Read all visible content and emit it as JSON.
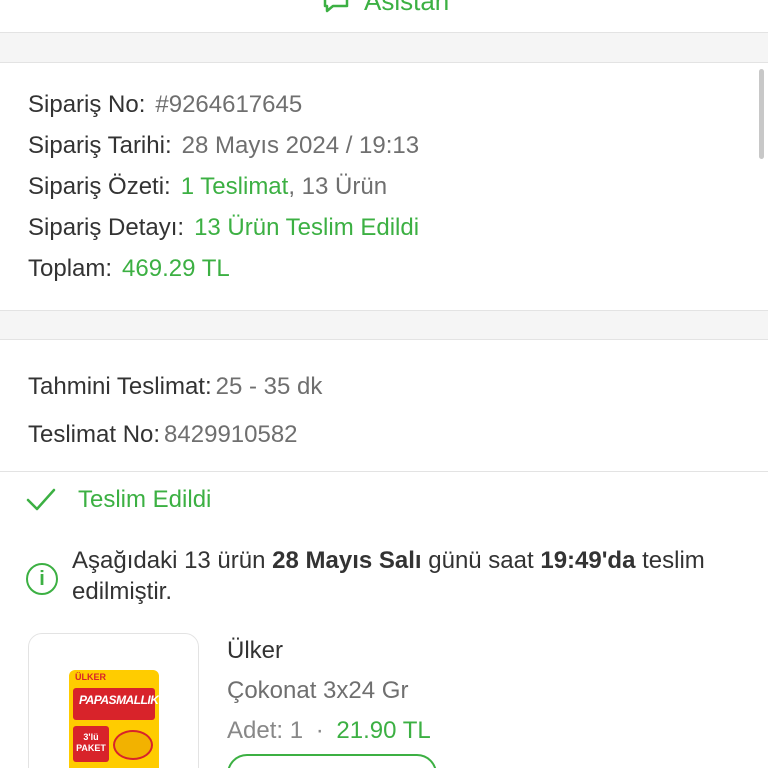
{
  "header": {
    "assistant_label": "Asistan"
  },
  "order": {
    "number_label": "Sipariş No:",
    "number_value": "#9264617645",
    "date_label": "Sipariş Tarihi:",
    "date_value": "28 Mayıs 2024 / 19:13",
    "summary_label": "Sipariş Özeti:",
    "summary_delivery": "1 Teslimat",
    "summary_items": ", 13 Ürün",
    "detail_label": "Sipariş Detayı:",
    "detail_value": "13 Ürün Teslim Edildi",
    "total_label": "Toplam:",
    "total_value": "469.29 TL"
  },
  "delivery": {
    "eta_label": "Tahmini Teslimat:",
    "eta_value": "25 - 35 dk",
    "number_label": "Teslimat No:",
    "number_value": "8429910582",
    "status": "Teslim Edildi",
    "info_prefix": "Aşağıdaki 13 ürün ",
    "info_date": "28 Mayıs Salı",
    "info_mid": " günü saat ",
    "info_time": "19:49'da",
    "info_suffix": " teslim edilmiştir."
  },
  "product": {
    "brand": "Ülker",
    "name": "Çokonat 3x24 Gr",
    "qty_label": "Adet:",
    "qty_value": "1",
    "separator": "·",
    "price": "21.90 TL",
    "pack_brand": "ÜLKER",
    "pack_name": "PAPASMALLIK",
    "pack_badge": "3'lü PAKET"
  },
  "colors": {
    "accent": "#3cb043",
    "text": "#333333",
    "muted": "#6f6f6f",
    "background": "#f5f5f5"
  },
  "icons": {
    "assistant": "chat-bubble-icon",
    "status": "check-icon",
    "info": "info-circle-icon"
  }
}
